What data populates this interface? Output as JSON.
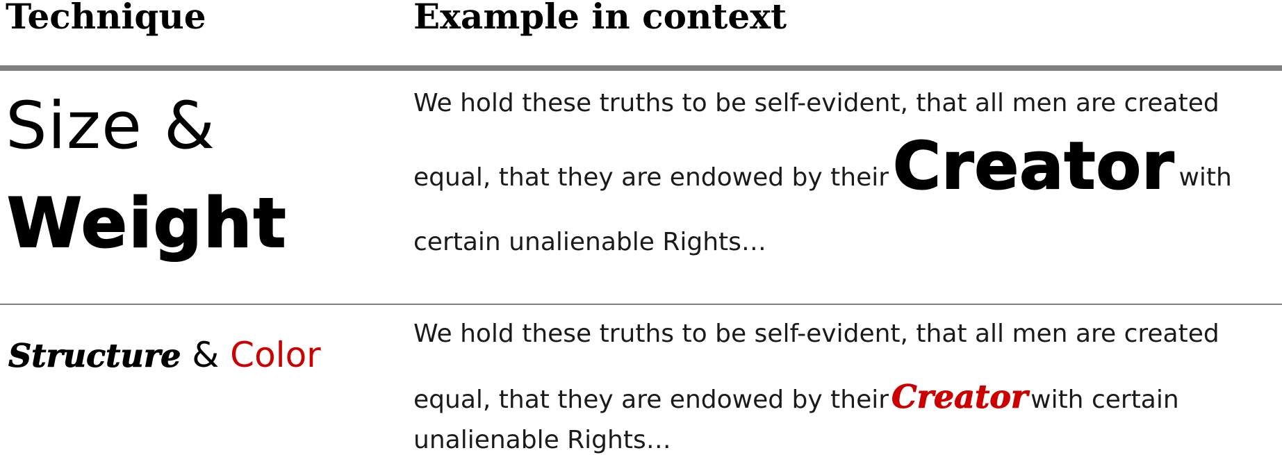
{
  "header": {
    "technique_label": "Technique",
    "example_label": "Example in context"
  },
  "rows": [
    {
      "technique": {
        "part1": "Size &",
        "part2": "Weight"
      },
      "example": {
        "line1": "We hold these truths to be self-evident, that all men are created",
        "line2_before": "equal, that they are endowed by their",
        "highlight": "Creator",
        "line2_after": "with",
        "line3": "certain unalienable Rights…"
      }
    },
    {
      "technique": {
        "part1": "Structure",
        "amp": "&",
        "part2": "Color"
      },
      "example": {
        "line1": "We hold these truths to be self-evident, that all men are created",
        "line2_before": "equal, that they are endowed by their",
        "highlight": "Creator",
        "line2_after": "with certain",
        "line3": "unalienable Rights…"
      }
    }
  ],
  "colors": {
    "rule": "#808080",
    "highlight_red": "#cc0000"
  }
}
